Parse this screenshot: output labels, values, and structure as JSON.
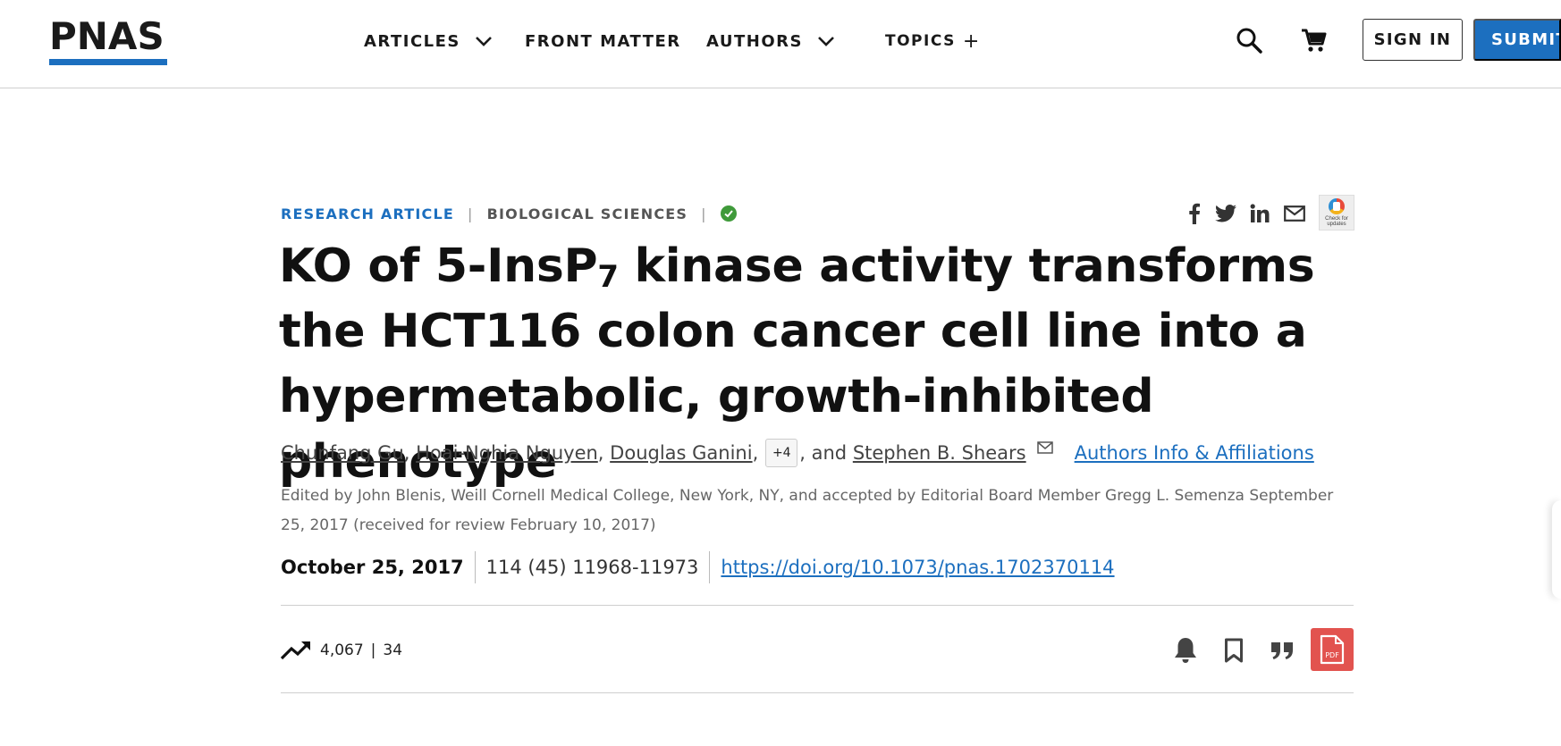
{
  "header": {
    "logo_text": "PNAS",
    "nav": [
      {
        "label": "ARTICLES",
        "has_dropdown": true
      },
      {
        "label": "FRONT MATTER",
        "has_dropdown": false
      },
      {
        "label": "AUTHORS",
        "has_dropdown": true
      },
      {
        "label": "TOPICS",
        "has_plus": true
      }
    ],
    "topics_plus": "+",
    "search_icon": "search-icon",
    "cart_icon": "cart-icon",
    "signin_label": "SIGN IN",
    "submit_label": "SUBMIT",
    "brand_color": "#1c6fbf"
  },
  "article": {
    "type": "RESEARCH ARTICLE",
    "subject": "BIOLOGICAL SCIENCES",
    "sep": "|",
    "status_icon": "check-circle-icon",
    "share_icons": [
      "facebook-icon",
      "twitter-icon",
      "linkedin-icon",
      "email-icon"
    ],
    "crossmark_text": "Check for updates",
    "title_part1": "KO of 5-InsP",
    "title_sub": "7",
    "title_part2": " kinase activity transforms the HCT116 colon cancer cell line into a hypermetabolic, growth-inhibited phenotype",
    "authors": [
      "Chunfang Gu",
      "Hoai-Nghia Nguyen",
      "Douglas Ganini"
    ],
    "author_sep": ",",
    "more_authors": "+4",
    "and_text": ", and",
    "last_author": "Stephen B. Shears",
    "affiliations_link": "Authors Info & Affiliations",
    "edited_by": "Edited by John Blenis, Weill Cornell Medical College, New York, NY, and accepted by Editorial Board Member Gregg L. Semenza September 25, 2017 (received for review February 10, 2017)",
    "pub_date": "October 25, 2017",
    "volume_info": "114 (45) 11968-11973",
    "doi": "https://doi.org/10.1073/pnas.1702370114",
    "views": "4,067",
    "metric_sep": "|",
    "citations": "34",
    "pdf_label": "PDF",
    "pdf_color": "#e2534f"
  }
}
